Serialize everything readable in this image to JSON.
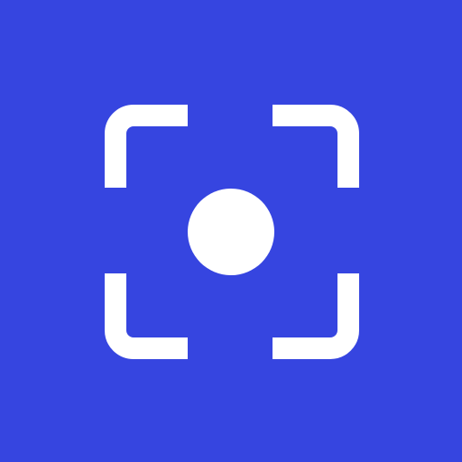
{
  "icon": {
    "name": "focus-capture-icon",
    "colors": {
      "background": "#3645e0",
      "foreground": "#ffffff"
    }
  }
}
